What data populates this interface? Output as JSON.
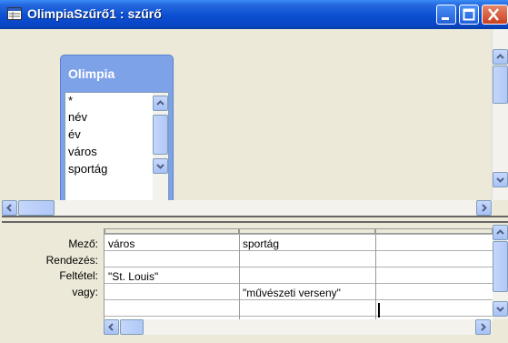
{
  "window": {
    "title": "OlimpiaSzűrő1 : szűrő"
  },
  "table_box": {
    "title": "Olimpia",
    "fields": [
      "*",
      "név",
      "év",
      "város",
      "sportág"
    ]
  },
  "grid": {
    "row_labels": [
      "Mező:",
      "Rendezés:",
      "Feltétel:",
      "vagy:"
    ],
    "columns": [
      {
        "mezo": "város",
        "rendezes": "",
        "feltetel": "\"St. Louis\"",
        "vagy": ""
      },
      {
        "mezo": "sportág",
        "rendezes": "",
        "feltetel": "",
        "vagy": "\"művészeti verseny\""
      },
      {
        "mezo": "",
        "rendezes": "",
        "feltetel": "",
        "vagy": ""
      }
    ]
  }
}
